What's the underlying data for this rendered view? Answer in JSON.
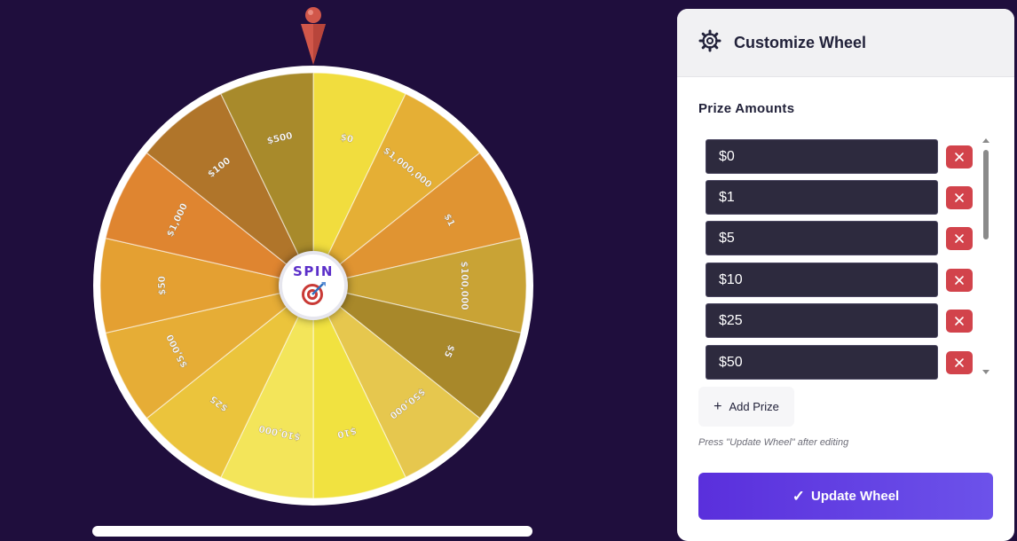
{
  "wheel": {
    "segments": [
      {
        "label": "$0",
        "color": "#f1dd3e"
      },
      {
        "label": "$1,000,000",
        "color": "#e5af35"
      },
      {
        "label": "$1",
        "color": "#e09432"
      },
      {
        "label": "$100,000",
        "color": "#c9a335"
      },
      {
        "label": "$5",
        "color": "#a8882a"
      },
      {
        "label": "$50,000",
        "color": "#e6c74e"
      },
      {
        "label": "$10",
        "color": "#f1e240"
      },
      {
        "label": "$10,000",
        "color": "#f3e55a"
      },
      {
        "label": "$25",
        "color": "#ebc43c"
      },
      {
        "label": "$5,000",
        "color": "#e6ad36"
      },
      {
        "label": "$50",
        "color": "#e4a032"
      },
      {
        "label": "$1,000",
        "color": "#df8530"
      },
      {
        "label": "$100",
        "color": "#b0752a"
      },
      {
        "label": "$500",
        "color": "#a88a2b"
      }
    ],
    "spin_label": "SPIN",
    "spin_icon": "target-icon",
    "pointer_color": "#d1574a"
  },
  "panel": {
    "title": "Customize Wheel",
    "title_icon": "gear-icon",
    "section_title": "Prize Amounts",
    "prizes": [
      "$0",
      "$1",
      "$5",
      "$10",
      "$25",
      "$50"
    ],
    "remove_icon": "close-icon",
    "add_label": "Add Prize",
    "hint": "Press \"Update Wheel\" after editing",
    "update_label": "Update Wheel",
    "accent": "#5a2fdc"
  }
}
